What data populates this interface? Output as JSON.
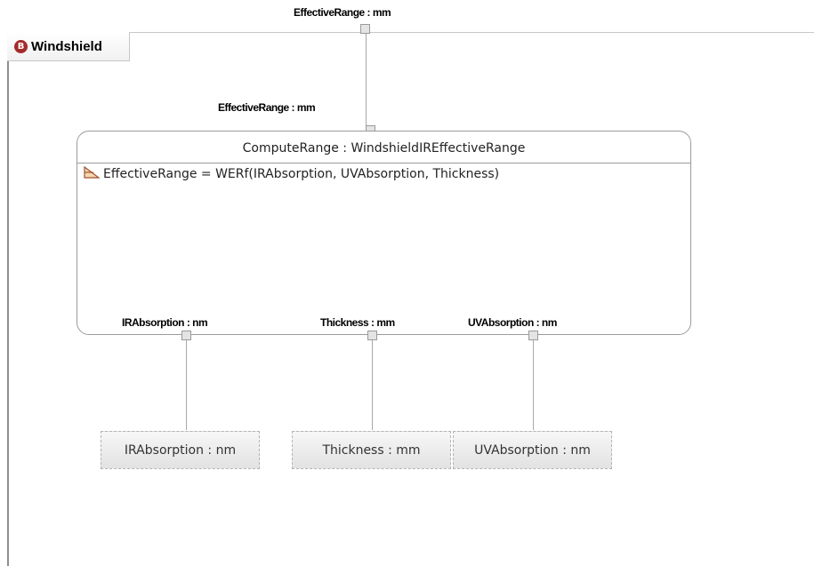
{
  "diagram": {
    "outer_port_label": "EffectiveRange : mm",
    "block_tab": {
      "icon": "block-b-icon",
      "icon_letter": "B",
      "label": "Windshield"
    },
    "constraint": {
      "header": "ComputeRange : WindshieldIREffectiveRange",
      "equation_icon": "constraint-icon",
      "equation": "EffectiveRange = WERf(IRAbsorption, UVAbsorption, Thickness)",
      "top_port_label": "EffectiveRange : mm",
      "bottom_ports": [
        "IRAbsorption : nm",
        "Thickness : mm",
        "UVAbsorption : nm"
      ]
    },
    "parameters": [
      "IRAbsorption : nm",
      "Thickness : mm",
      "UVAbsorption : nm"
    ]
  },
  "colors": {
    "tab_icon": "#a52a2a",
    "border": "#9b9b9b",
    "port_fill": "#e4e4e4"
  }
}
